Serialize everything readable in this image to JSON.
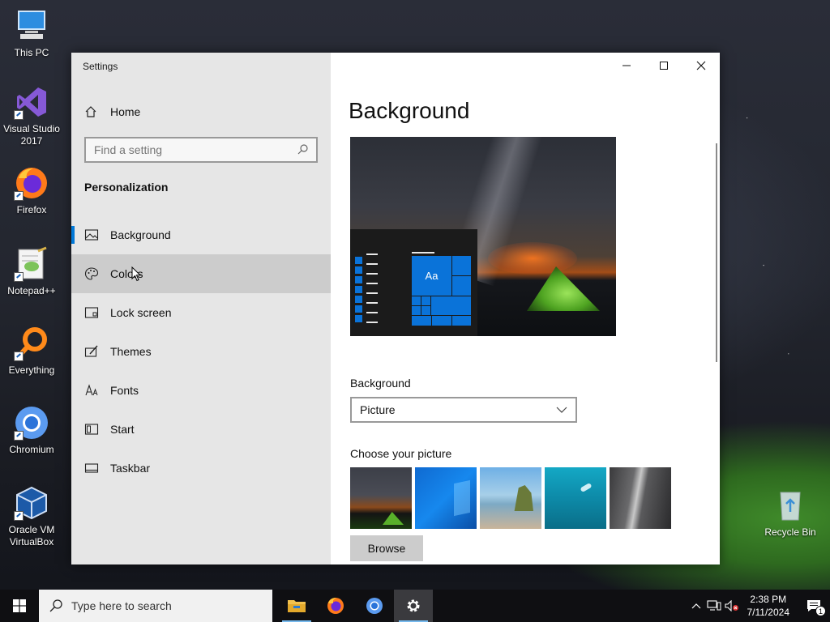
{
  "desktop": {
    "icons": [
      {
        "label": "This PC"
      },
      {
        "label": "Visual Studio 2017"
      },
      {
        "label": "Firefox"
      },
      {
        "label": "Notepad++"
      },
      {
        "label": "Everything"
      },
      {
        "label": "Chromium"
      },
      {
        "label": "Oracle VM VirtualBox"
      },
      {
        "label": "Recycle Bin"
      }
    ]
  },
  "window": {
    "title": "Settings",
    "sidebar": {
      "home_label": "Home",
      "search_placeholder": "Find a setting",
      "section_title": "Personalization",
      "items": [
        {
          "label": "Background",
          "icon": "picture-icon"
        },
        {
          "label": "Colors",
          "icon": "palette-icon"
        },
        {
          "label": "Lock screen",
          "icon": "lock-screen-icon"
        },
        {
          "label": "Themes",
          "icon": "themes-icon"
        },
        {
          "label": "Fonts",
          "icon": "fonts-icon"
        },
        {
          "label": "Start",
          "icon": "start-icon"
        },
        {
          "label": "Taskbar",
          "icon": "taskbar-icon"
        }
      ],
      "selected": "Background",
      "hovered": "Colors"
    },
    "content": {
      "page_title": "Background",
      "preview_tile_text": "Aa",
      "background_label": "Background",
      "background_value": "Picture",
      "choose_picture_label": "Choose your picture",
      "browse_label": "Browse"
    }
  },
  "taskbar": {
    "search_placeholder": "Type here to search",
    "time": "2:38 PM",
    "date": "7/11/2024",
    "notification_count": "1"
  },
  "colors": {
    "accent": "#0078d7",
    "sidebar_bg": "#e6e6e6",
    "taskbar_bg": "#0f0f12"
  }
}
